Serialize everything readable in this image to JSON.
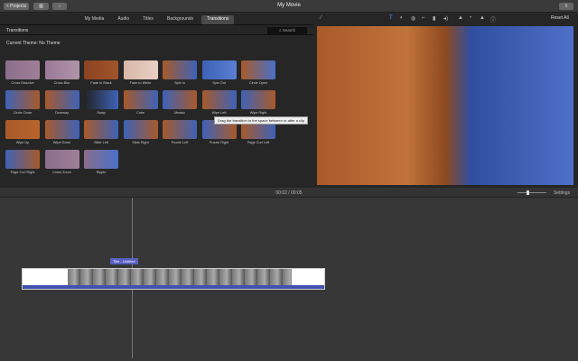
{
  "toolbar": {
    "projects_label": "< Projects",
    "title": "My Movie",
    "reset_all": "Reset All"
  },
  "browser": {
    "tabs": [
      {
        "label": "My Media"
      },
      {
        "label": "Audio"
      },
      {
        "label": "Titles"
      },
      {
        "label": "Backgrounds"
      },
      {
        "label": "Transitions",
        "active": true
      }
    ],
    "header": "Transitions",
    "search_placeholder": "Search",
    "theme": "Current Theme: No Theme",
    "transitions": [
      {
        "label": "Cross Dissolve",
        "colors": [
          "#8a6e8c",
          "#a08098"
        ]
      },
      {
        "label": "Cross Blur",
        "colors": [
          "#9a7a98",
          "#b094a8"
        ]
      },
      {
        "label": "Fade to Black",
        "colors": [
          "#8a4420",
          "#a0542a"
        ]
      },
      {
        "label": "Fade to White",
        "colors": [
          "#d8b8a8",
          "#e8d0c4"
        ]
      },
      {
        "label": "Spin In",
        "colors": [
          "#a85a2a",
          "#3e62b8"
        ]
      },
      {
        "label": "Spin Out",
        "colors": [
          "#3e62b8",
          "#5a7ed0"
        ]
      },
      {
        "label": "Circle Open",
        "colors": [
          "#a85a2a",
          "#4a70c8"
        ]
      },
      {
        "label": "Circle Close",
        "colors": [
          "#3e62b8",
          "#a85a2a"
        ]
      },
      {
        "label": "Doorway",
        "colors": [
          "#a85a2a",
          "#3e62b8"
        ]
      },
      {
        "label": "Swap",
        "colors": [
          "#222",
          "#3e62b8"
        ]
      },
      {
        "label": "Cube",
        "colors": [
          "#a85a2a",
          "#3e62b8"
        ]
      },
      {
        "label": "Mosaic",
        "colors": [
          "#3e62b8",
          "#a85a2a"
        ]
      },
      {
        "label": "Wipe Left",
        "colors": [
          "#a85a2a",
          "#3e62b8"
        ]
      },
      {
        "label": "Wipe Right",
        "colors": [
          "#3e62b8",
          "#a85a2a"
        ]
      },
      {
        "label": "Wipe Up",
        "colors": [
          "#a85a2a",
          "#b8642c"
        ]
      },
      {
        "label": "Wipe Down",
        "colors": [
          "#a85a2a",
          "#3e62b8"
        ]
      },
      {
        "label": "Slide Left",
        "colors": [
          "#a85a2a",
          "#3e62b8"
        ]
      },
      {
        "label": "Slide Right",
        "colors": [
          "#3e62b8",
          "#a85a2a"
        ]
      },
      {
        "label": "Puzzle Left",
        "colors": [
          "#a85a2a",
          "#3e62b8"
        ]
      },
      {
        "label": "Puzzle Right",
        "colors": [
          "#3e62b8",
          "#a85a2a"
        ]
      },
      {
        "label": "Page Curl Left",
        "colors": [
          "#a85a2a",
          "#3e62b8"
        ]
      },
      {
        "label": "Page Curl Right",
        "colors": [
          "#3e62b8",
          "#a85a2a"
        ]
      },
      {
        "label": "Cross Zoom",
        "colors": [
          "#8a6e8c",
          "#a08098"
        ]
      },
      {
        "label": "Ripple",
        "colors": [
          "#8a6e8c",
          "#4a70c8"
        ]
      }
    ],
    "tooltip": "Drag the transition to the space between or after a clip"
  },
  "timeline": {
    "timecode": "00:02 / 00:05",
    "settings_label": "Settings",
    "zoom_level": 0.3,
    "clip_title": "Title - Untitled"
  }
}
